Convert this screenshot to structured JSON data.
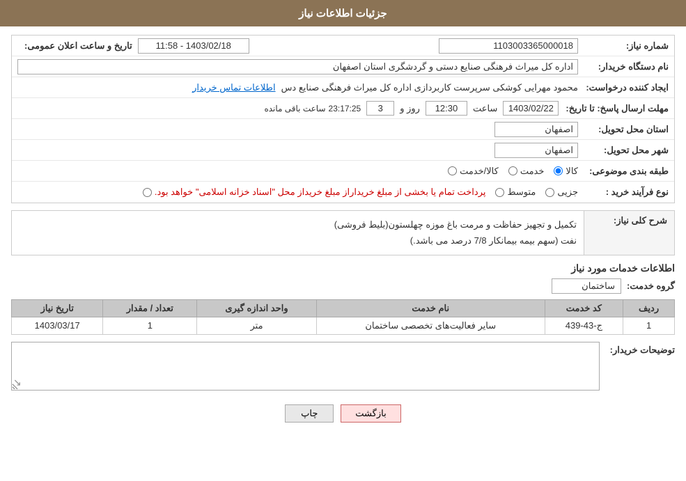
{
  "header": {
    "title": "جزئیات اطلاعات نیاز"
  },
  "fields": {
    "need_number_label": "شماره نیاز:",
    "need_number_value": "1103003365000018",
    "announce_datetime_label": "تاریخ و ساعت اعلان عمومی:",
    "announce_datetime_value": "1403/02/18 - 11:58",
    "buyer_name_label": "نام دستگاه خریدار:",
    "buyer_name_value": "اداره کل میراث فرهنگی  صنایع دستی و گردشگری استان اصفهان",
    "creator_label": "ایجاد کننده درخواست:",
    "creator_value": "محمود مهرایی کوشکی سرپرست کاربردازی اداره کل میراث فرهنگی  صنایع دس",
    "contact_link": "اطلاعات تماس خریدار",
    "deadline_label": "مهلت ارسال پاسخ: تا تاریخ:",
    "deadline_date": "1403/02/22",
    "deadline_time_label": "ساعت",
    "deadline_time": "12:30",
    "deadline_days_label": "روز و",
    "deadline_days": "3",
    "deadline_remaining_label": "ساعت باقی مانده",
    "deadline_remaining": "23:17:25",
    "province_delivery_label": "استان محل تحویل:",
    "province_delivery_value": "اصفهان",
    "city_delivery_label": "شهر محل تحویل:",
    "city_delivery_value": "اصفهان",
    "category_label": "طبقه بندی موضوعی:",
    "category_options": [
      "کالا",
      "خدمت",
      "کالا/خدمت"
    ],
    "category_selected": "کالا",
    "purchase_type_label": "نوع فرآیند خرید :",
    "purchase_type_options": [
      "جزیی",
      "متوسط",
      "پرداخت تمام یا بخشی از مبلغ خریدار محل «اسناد خزانه اسلامی» خواهد بود."
    ],
    "purchase_notice": "پرداخت تمام یا بخشی از مبلغ خریداراز مبلغ خریداز محل \"اسناد خزانه اسلامی\" خواهد بود."
  },
  "description": {
    "section_title": "شرح کلی نیاز:",
    "text_line1": "تکمیل و تجهیز حفاظت و مرمت باغ موزه چهلستون(بلیط فروشی)",
    "text_line2": "نفت (سهم بیمه بیمانکار 7/8 درصد می باشد.)"
  },
  "services": {
    "section_title": "اطلاعات خدمات مورد نیاز",
    "group_label": "گروه خدمت:",
    "group_value": "ساختمان",
    "table": {
      "headers": [
        "ردیف",
        "کد خدمت",
        "نام خدمت",
        "واحد اندازه گیری",
        "تعداد / مقدار",
        "تاریخ نیاز"
      ],
      "rows": [
        {
          "row_num": "1",
          "service_code": "ج-43-439",
          "service_name": "سایر فعالیت‌های تخصصی ساختمان",
          "unit": "متر",
          "quantity": "1",
          "date_needed": "1403/03/17"
        }
      ]
    }
  },
  "buyer_notes": {
    "label": "توضیحات خریدار:",
    "placeholder": ""
  },
  "buttons": {
    "print_label": "چاپ",
    "back_label": "بازگشت"
  }
}
